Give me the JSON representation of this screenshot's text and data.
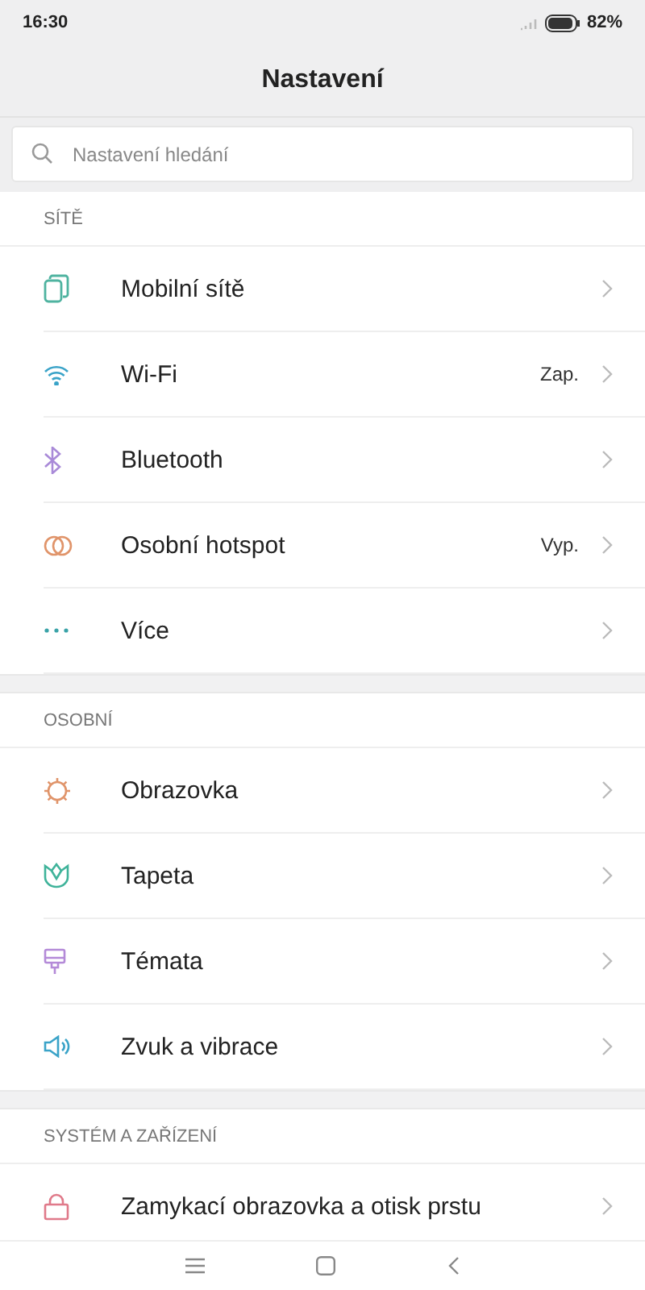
{
  "status_bar": {
    "time": "16:30",
    "battery": "82%"
  },
  "title": "Nastavení",
  "search": {
    "placeholder": "Nastavení hledání"
  },
  "sections": [
    {
      "title": "SÍTĚ",
      "items": [
        {
          "label": "Mobilní sítě",
          "kind": "sim",
          "color": "#4fb3a0"
        },
        {
          "label": "Wi-Fi",
          "value": "Zap.",
          "kind": "wifi",
          "color": "#3aa3c8"
        },
        {
          "label": "Bluetooth",
          "kind": "bluetooth",
          "color": "#a98ad8"
        },
        {
          "label": "Osobní hotspot",
          "value": "Vyp.",
          "kind": "hotspot",
          "color": "#e0946a"
        },
        {
          "label": "Více",
          "kind": "more",
          "color": "#3aa3a8"
        }
      ]
    },
    {
      "title": "OSOBNÍ",
      "items": [
        {
          "label": "Obrazovka",
          "kind": "sun",
          "color": "#e0946a"
        },
        {
          "label": "Tapeta",
          "kind": "tulip",
          "color": "#3fb39a"
        },
        {
          "label": "Témata",
          "kind": "brush",
          "color": "#b48ad8"
        },
        {
          "label": "Zvuk a vibrace",
          "kind": "speaker",
          "color": "#3aa3c8"
        }
      ]
    },
    {
      "title": "SYSTÉM A ZAŘÍZENÍ",
      "items": [
        {
          "label": "Zamykací obrazovka a otisk prstu",
          "kind": "lock",
          "color": "#e07a8a"
        }
      ]
    }
  ]
}
